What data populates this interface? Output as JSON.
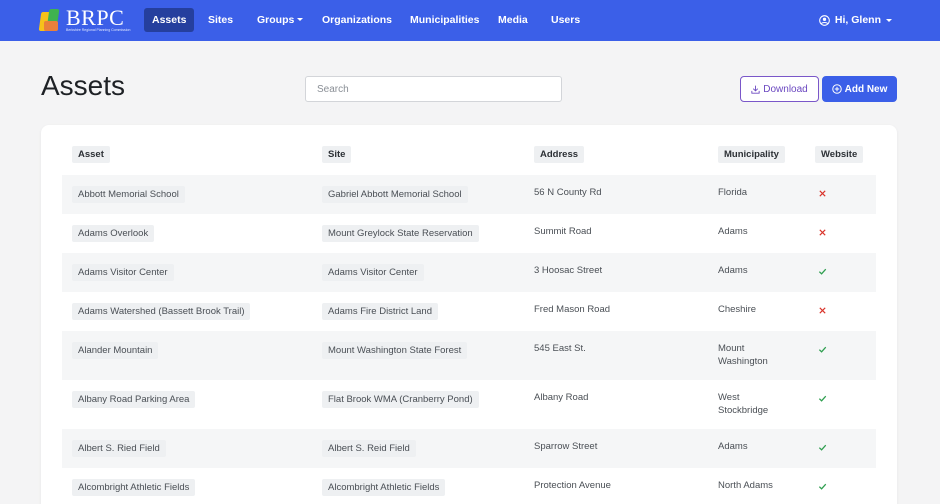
{
  "brand": {
    "name": "BRPC",
    "tagline": "Berkshire Regional Planning Commission"
  },
  "nav": {
    "items": [
      {
        "label": "Assets",
        "active": true
      },
      {
        "label": "Sites"
      },
      {
        "label": "Groups",
        "dropdown": true
      },
      {
        "label": "Organizations"
      },
      {
        "label": "Municipalities"
      },
      {
        "label": "Media"
      },
      {
        "label": "Users"
      }
    ],
    "user_label": "Hi, Glenn"
  },
  "page": {
    "title": "Assets"
  },
  "search": {
    "placeholder": "Search",
    "value": ""
  },
  "actions": {
    "download_label": "Download",
    "add_label": "Add New"
  },
  "colors": {
    "navbar": "#3b5fe8",
    "active_nav": "#253f9e",
    "yes": "#2e9e4f",
    "no": "#d9342b",
    "download_outline": "#7a57c9"
  },
  "table": {
    "columns": [
      "Asset",
      "Site",
      "Address",
      "Municipality",
      "Website"
    ],
    "rows": [
      {
        "asset": "Abbott Memorial School",
        "site": "Gabriel Abbott Memorial School",
        "address": "56 N County Rd",
        "municipality": "Florida",
        "website": false
      },
      {
        "asset": "Adams Overlook",
        "site": "Mount Greylock State Reservation",
        "address": "Summit Road",
        "municipality": "Adams",
        "website": false
      },
      {
        "asset": "Adams Visitor Center",
        "site": "Adams Visitor Center",
        "address": "3 Hoosac Street",
        "municipality": "Adams",
        "website": true
      },
      {
        "asset": "Adams Watershed (Bassett Brook Trail)",
        "site": "Adams Fire District Land",
        "address": "Fred Mason Road",
        "municipality": "Cheshire",
        "website": false
      },
      {
        "asset": "Alander Mountain",
        "site": "Mount Washington State Forest",
        "address": "545 East St.",
        "municipality": "Mount Washington",
        "website": true
      },
      {
        "asset": "Albany Road Parking Area",
        "site": "Flat Brook WMA (Cranberry Pond)",
        "address": "Albany Road",
        "municipality": "West Stockbridge",
        "website": true
      },
      {
        "asset": "Albert S. Ried Field",
        "site": "Albert S. Reid Field",
        "address": "Sparrow Street",
        "municipality": "Adams",
        "website": true
      },
      {
        "asset": "Alcombright Athletic Fields",
        "site": "Alcombright Athletic Fields",
        "address": "Protection Avenue",
        "municipality": "North Adams",
        "website": true
      }
    ]
  }
}
